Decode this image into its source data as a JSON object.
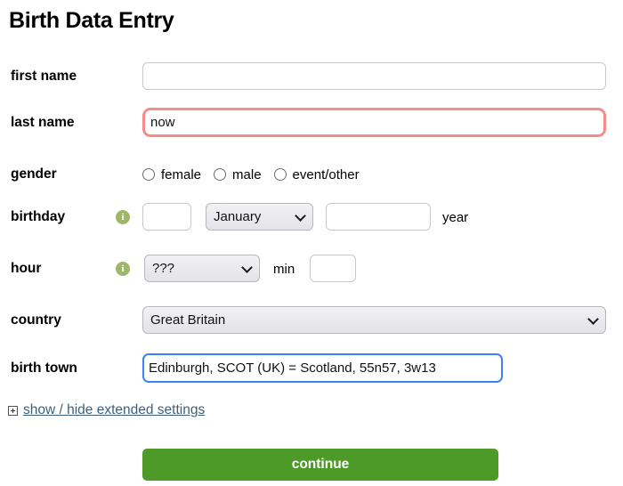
{
  "page": {
    "title": "Birth Data Entry"
  },
  "form": {
    "first_name": {
      "label": "first name",
      "value": "",
      "placeholder": ""
    },
    "last_name": {
      "label": "last name",
      "value": "now",
      "placeholder": ""
    },
    "gender": {
      "label": "gender",
      "options": [
        {
          "label": "female",
          "value": "female",
          "selected": false
        },
        {
          "label": "male",
          "value": "male",
          "selected": false
        },
        {
          "label": "event/other",
          "value": "event/other",
          "selected": false
        }
      ]
    },
    "birthday": {
      "label": "birthday",
      "info_icon": "info-icon",
      "day": {
        "value": "",
        "placeholder": ""
      },
      "month": {
        "selected": "January"
      },
      "year": {
        "value": "",
        "placeholder": ""
      },
      "year_label": "year"
    },
    "hour": {
      "label": "hour",
      "info_icon": "info-icon",
      "hour_select": {
        "selected": "???"
      },
      "min_label": "min",
      "min": {
        "value": "",
        "placeholder": ""
      }
    },
    "country": {
      "label": "country",
      "selected": "Great Britain"
    },
    "birth_town": {
      "label": "birth town",
      "value": "Edinburgh, SCOT (UK) = Scotland, 55n57, 3w13",
      "placeholder": ""
    }
  },
  "extended_settings": {
    "icon": "plus-box-icon",
    "link_text": "show / hide extended settings"
  },
  "actions": {
    "continue_label": "continue"
  },
  "colors": {
    "error_border": "#f48c8c",
    "focus_border": "#3b82f6",
    "info_icon_bg": "#9fb867",
    "continue_bg": "#4e9a28",
    "link": "#3b5f7a"
  }
}
